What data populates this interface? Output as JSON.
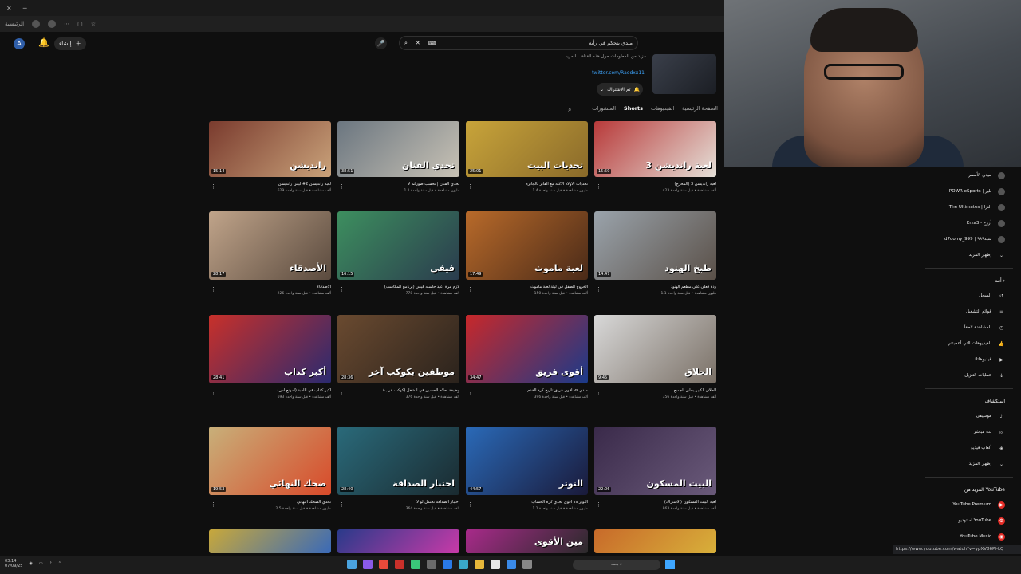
{
  "browser": {
    "tab_icon": "x-icon",
    "bookmark_label": "الرئيسية"
  },
  "header": {
    "avatar_letter": "A",
    "create_label": "إنشاء",
    "search_query": "ميدي يتحكم في رأيه"
  },
  "channel": {
    "description": "مزيد من المعلومات حول هذه القناة ...المزيد",
    "link": "twitter.com/Raedxx11",
    "subscribed_label": "تم الاشتراك",
    "tabs": [
      "الصفحة الرئيسية",
      "الفيديوهات",
      "Shorts",
      "المنشورات"
    ],
    "active_tab_index": 2
  },
  "videos": [
    {
      "label": "رانديشن",
      "duration": "15:14",
      "title": "لعبة رانديشن 2# ليش رانديشن",
      "meta": "629 ألف مشاهدة • قبل سنة واحدة",
      "c1": "#7a3b2e",
      "c2": "#c9a27a"
    },
    {
      "label": "تحدي الفنان",
      "duration": "38:51",
      "title": "تحدي الفنان | نحسب صوركم لا",
      "meta": "1.1 مليون مشاهدة • قبل سنة واحدة",
      "c1": "#6b7680",
      "c2": "#c8c2b5"
    },
    {
      "label": "تحديات البيت",
      "duration": "25:01",
      "title": "تحديات الأولاد الأكلة مع الفائز بالجائزة",
      "meta": "1.4 مليون مشاهدة • قبل سنة واحدة",
      "c1": "#c8a43a",
      "c2": "#8a6a2a"
    },
    {
      "label": "لعبة رانديشن 3",
      "duration": "15:50",
      "title": "لعبة رانديشن 3 (المخرج)",
      "meta": "423 ألف مشاهدة • قبل سنة واحدة",
      "c1": "#b83a3a",
      "c2": "#e5e0d8"
    },
    {
      "label": "الأصدقاء",
      "duration": "28:17",
      "title": "الأصدقاء",
      "meta": "226 ألف مشاهدة • قبل سنة واحدة",
      "c1": "#c0a48a",
      "c2": "#5a4a3e"
    },
    {
      "label": "فيفي",
      "duration": "16:15",
      "title": "لازم مرة أعيد حاسبه فيفي (برنامج المكاسب)",
      "meta": "778 ألف مشاهدة • قبل سنة واحدة",
      "c1": "#3d8f5f",
      "c2": "#2a3b4d"
    },
    {
      "label": "لعبة ماموث",
      "duration": "17:49",
      "title": "الخروج الطفل في ليلة لعبة ماموث",
      "meta": "150 ألف مشاهدة • قبل سنة واحدة",
      "c1": "#b86a2a",
      "c2": "#4a2a18"
    },
    {
      "label": "طبخ الهنود",
      "duration": "14:47",
      "title": "ردة فعلي على مطعم الهنود",
      "meta": "1.1 مليون مشاهدة • قبل سنة واحدة",
      "c1": "#9aa3ab",
      "c2": "#5a5048"
    },
    {
      "label": "أكبر كذاب",
      "duration": "28:41",
      "title": "أكبر كذاب في اللعبة (أمونج أس)",
      "meta": "693 ألف مشاهدة • قبل سنة واحدة",
      "c1": "#c8302a",
      "c2": "#2a2a70"
    },
    {
      "label": "موظفين بكوكب آخر",
      "duration": "28:36",
      "title": "وظيفة أحلام الحسين في الشغل (كوكب عرب)",
      "meta": "376 ألف مشاهدة • قبل سنة واحدة",
      "c1": "#6a4a30",
      "c2": "#2a221c"
    },
    {
      "label": "أقوى فريق",
      "duration": "34:47",
      "title": "أقوى فريق تاريخ كرة القدم vs ميدي",
      "meta": "396 ألف مشاهدة • قبل سنة واحدة",
      "c1": "#c8282a",
      "c2": "#1a3a8a"
    },
    {
      "label": "الحلاق",
      "duration": "9:45",
      "title": "الحلاق الكبير يحلق للجميع",
      "meta": "356 ألف مشاهدة • قبل سنة واحدة",
      "c1": "#d8d8d8",
      "c2": "#7a7066"
    },
    {
      "label": "ضحك النهائي",
      "duration": "19:53",
      "title": "تحدي الضحك النهائي",
      "meta": "2.5 مليون مشاهدة • قبل سنة واحدة",
      "c1": "#c8b07a",
      "c2": "#d84a2a"
    },
    {
      "label": "اختبار الصداقة",
      "duration": "28:40",
      "title": "اختبار الصداقة تحتمل لو لا",
      "meta": "364 ألف مشاهدة • قبل سنة واحدة",
      "c1": "#2a6a7a",
      "c2": "#1a2a30"
    },
    {
      "label": "التوتر",
      "duration": "44:57",
      "title": "أقوى تحدي كرة الحساب vs التوتر",
      "meta": "1.1 مليون مشاهدة • قبل سنة واحدة",
      "c1": "#2a6ab8",
      "c2": "#1a1a3a"
    },
    {
      "label": "البيت المسكون",
      "duration": "22:06",
      "title": "لعبة البيت المسكون (الاشتراك)",
      "meta": "863 ألف مشاهدة • قبل سنة واحدة",
      "c1": "#3a2a4a",
      "c2": "#6a5a7a"
    },
    {
      "label": "",
      "duration": "",
      "title": "",
      "meta": "",
      "c1": "#c8a83a",
      "c2": "#3a6ab8"
    },
    {
      "label": "",
      "duration": "",
      "title": "",
      "meta": "",
      "c1": "#2a3a8a",
      "c2": "#c83aa8"
    },
    {
      "label": "مين الأقوى",
      "duration": "",
      "title": "",
      "meta": "",
      "c1": "#a82a8a",
      "c2": "#2a2a2a"
    },
    {
      "label": "",
      "duration": "",
      "title": "",
      "meta": "",
      "c1": "#c86a2a",
      "c2": "#d8b03a"
    }
  ],
  "sidebar": {
    "subscriptions": [
      {
        "label": "ميدي الأسمر",
        "icon": "avatar-icon"
      },
      {
        "label": "POWR eSports | بلير",
        "icon": "avatar-icon"
      },
      {
        "label": "The Ultimates | الترا",
        "icon": "avatar-icon"
      },
      {
        "label": "Erza3 - أرزع",
        "icon": "avatar-icon"
      },
      {
        "label": "d7oomy_999 | سيد٩٩٩",
        "icon": "avatar-icon"
      },
      {
        "label": "إظهار المزيد",
        "icon": "chevron-down-icon"
      }
    ],
    "you_title": "أنت",
    "you_items": [
      {
        "label": "السجل",
        "icon": "history-icon"
      },
      {
        "label": "قوائم التشغيل",
        "icon": "playlist-icon"
      },
      {
        "label": "المشاهدة لاحقاً",
        "icon": "clock-icon"
      },
      {
        "label": "الفيديوهات التي أعجبتني",
        "icon": "like-icon"
      },
      {
        "label": "فيديوهاتك",
        "icon": "video-icon"
      },
      {
        "label": "عمليات التنزيل",
        "icon": "download-icon"
      }
    ],
    "explore_title": "استكشاف",
    "explore_items": [
      {
        "label": "موسيقى",
        "icon": "music-icon"
      },
      {
        "label": "بث مباشر",
        "icon": "live-icon"
      },
      {
        "label": "ألعاب فيديو",
        "icon": "gaming-icon"
      },
      {
        "label": "إظهار المزيد",
        "icon": "chevron-down-icon"
      }
    ],
    "more_title": "المزيد من YouTube",
    "more_items": [
      {
        "label": "YouTube Premium",
        "icon": "youtube-premium-icon"
      },
      {
        "label": "استوديو YouTube",
        "icon": "studio-icon"
      },
      {
        "label": "YouTube Music",
        "icon": "yt-music-icon"
      }
    ]
  },
  "status_url": "https://www.youtube.com/watch?v=ypXV86PI-LQ",
  "taskbar": {
    "search_placeholder": "بحث",
    "clock": "03:14",
    "date": "07/09/25"
  }
}
